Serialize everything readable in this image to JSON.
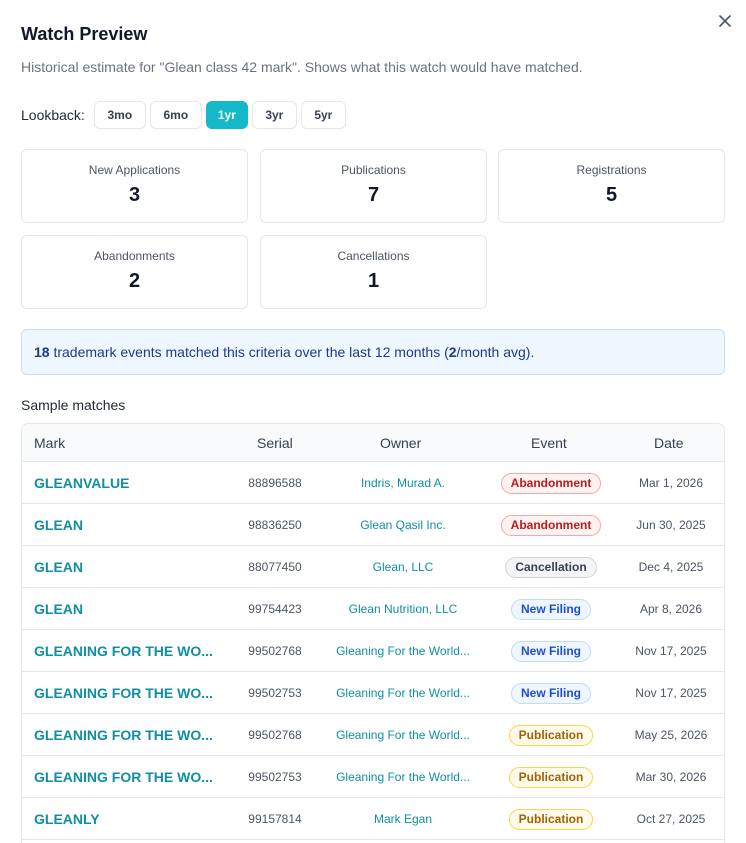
{
  "modal": {
    "title": "Watch Preview",
    "subtitle": "Historical estimate for \"Glean class 42 mark\". Shows what this watch would have matched.",
    "close_icon": "close-icon"
  },
  "lookback": {
    "label": "Lookback:",
    "options": [
      "3mo",
      "6mo",
      "1yr",
      "3yr",
      "5yr"
    ],
    "selected": "1yr"
  },
  "stats": [
    {
      "label": "New Applications",
      "value": "3"
    },
    {
      "label": "Publications",
      "value": "7"
    },
    {
      "label": "Registrations",
      "value": "5"
    },
    {
      "label": "Abandonments",
      "value": "2"
    },
    {
      "label": "Cancellations",
      "value": "1"
    }
  ],
  "summary": {
    "count": "18",
    "text_a": " trademark events matched this criteria over the last 12 months (",
    "avg": "2",
    "text_b": "/month avg)."
  },
  "sample": {
    "title": "Sample matches",
    "columns": [
      "Mark",
      "Serial",
      "Owner",
      "Event",
      "Date"
    ],
    "rows": [
      {
        "mark": "GLEANVALUE",
        "serial": "88896588",
        "owner": "Indris, Murad A.",
        "event": "Abandonment",
        "date": "Mar 1, 2026"
      },
      {
        "mark": "GLEAN",
        "serial": "98836250",
        "owner": "Glean Qasil Inc.",
        "event": "Abandonment",
        "date": "Jun 30, 2025"
      },
      {
        "mark": "GLEAN",
        "serial": "88077450",
        "owner": "Glean, LLC",
        "event": "Cancellation",
        "date": "Dec 4, 2025"
      },
      {
        "mark": "GLEAN",
        "serial": "99754423",
        "owner": "Glean Nutrition, LLC",
        "event": "New Filing",
        "date": "Apr 8, 2026"
      },
      {
        "mark": "GLEANING FOR THE WO...",
        "serial": "99502768",
        "owner": "Gleaning For the World...",
        "event": "New Filing",
        "date": "Nov 17, 2025"
      },
      {
        "mark": "GLEANING FOR THE WO...",
        "serial": "99502753",
        "owner": "Gleaning For the World...",
        "event": "New Filing",
        "date": "Nov 17, 2025"
      },
      {
        "mark": "GLEANING FOR THE WO...",
        "serial": "99502768",
        "owner": "Gleaning For the World...",
        "event": "Publication",
        "date": "May 25, 2026"
      },
      {
        "mark": "GLEANING FOR THE WO...",
        "serial": "99502753",
        "owner": "Gleaning For the World...",
        "event": "Publication",
        "date": "Mar 30, 2026"
      },
      {
        "mark": "GLEANLY",
        "serial": "99157814",
        "owner": "Mark Egan",
        "event": "Publication",
        "date": "Oct 27, 2025"
      }
    ]
  },
  "colors": {
    "accent": "#14b8c8",
    "link": "#0e8fa3",
    "abandonment": "#b91c1c",
    "cancellation": "#374151",
    "new_filing": "#1d4ed8",
    "publication": "#a16207"
  }
}
